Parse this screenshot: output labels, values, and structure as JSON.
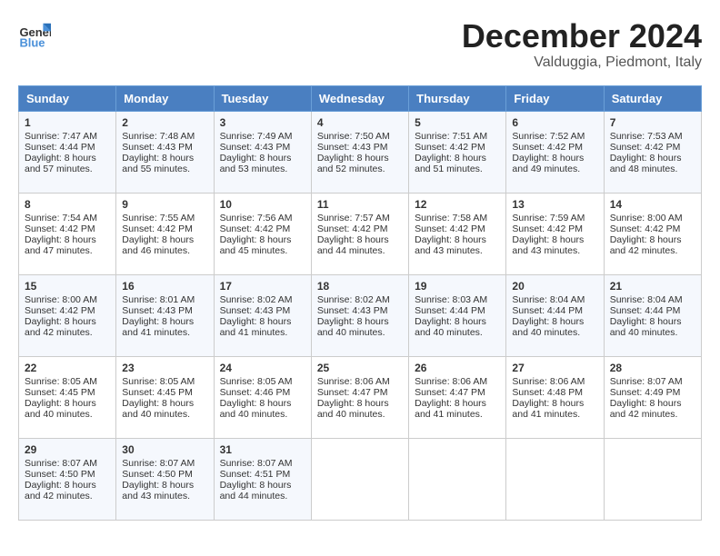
{
  "logo": {
    "line1": "General",
    "line2": "Blue"
  },
  "title": "December 2024",
  "location": "Valduggia, Piedmont, Italy",
  "days_of_week": [
    "Sunday",
    "Monday",
    "Tuesday",
    "Wednesday",
    "Thursday",
    "Friday",
    "Saturday"
  ],
  "weeks": [
    [
      {
        "day": 1,
        "sunrise": "7:47 AM",
        "sunset": "4:44 PM",
        "daylight": "8 hours and 57 minutes."
      },
      {
        "day": 2,
        "sunrise": "7:48 AM",
        "sunset": "4:43 PM",
        "daylight": "8 hours and 55 minutes."
      },
      {
        "day": 3,
        "sunrise": "7:49 AM",
        "sunset": "4:43 PM",
        "daylight": "8 hours and 53 minutes."
      },
      {
        "day": 4,
        "sunrise": "7:50 AM",
        "sunset": "4:43 PM",
        "daylight": "8 hours and 52 minutes."
      },
      {
        "day": 5,
        "sunrise": "7:51 AM",
        "sunset": "4:42 PM",
        "daylight": "8 hours and 51 minutes."
      },
      {
        "day": 6,
        "sunrise": "7:52 AM",
        "sunset": "4:42 PM",
        "daylight": "8 hours and 49 minutes."
      },
      {
        "day": 7,
        "sunrise": "7:53 AM",
        "sunset": "4:42 PM",
        "daylight": "8 hours and 48 minutes."
      }
    ],
    [
      {
        "day": 8,
        "sunrise": "7:54 AM",
        "sunset": "4:42 PM",
        "daylight": "8 hours and 47 minutes."
      },
      {
        "day": 9,
        "sunrise": "7:55 AM",
        "sunset": "4:42 PM",
        "daylight": "8 hours and 46 minutes."
      },
      {
        "day": 10,
        "sunrise": "7:56 AM",
        "sunset": "4:42 PM",
        "daylight": "8 hours and 45 minutes."
      },
      {
        "day": 11,
        "sunrise": "7:57 AM",
        "sunset": "4:42 PM",
        "daylight": "8 hours and 44 minutes."
      },
      {
        "day": 12,
        "sunrise": "7:58 AM",
        "sunset": "4:42 PM",
        "daylight": "8 hours and 43 minutes."
      },
      {
        "day": 13,
        "sunrise": "7:59 AM",
        "sunset": "4:42 PM",
        "daylight": "8 hours and 43 minutes."
      },
      {
        "day": 14,
        "sunrise": "8:00 AM",
        "sunset": "4:42 PM",
        "daylight": "8 hours and 42 minutes."
      }
    ],
    [
      {
        "day": 15,
        "sunrise": "8:00 AM",
        "sunset": "4:42 PM",
        "daylight": "8 hours and 42 minutes."
      },
      {
        "day": 16,
        "sunrise": "8:01 AM",
        "sunset": "4:43 PM",
        "daylight": "8 hours and 41 minutes."
      },
      {
        "day": 17,
        "sunrise": "8:02 AM",
        "sunset": "4:43 PM",
        "daylight": "8 hours and 41 minutes."
      },
      {
        "day": 18,
        "sunrise": "8:02 AM",
        "sunset": "4:43 PM",
        "daylight": "8 hours and 40 minutes."
      },
      {
        "day": 19,
        "sunrise": "8:03 AM",
        "sunset": "4:44 PM",
        "daylight": "8 hours and 40 minutes."
      },
      {
        "day": 20,
        "sunrise": "8:04 AM",
        "sunset": "4:44 PM",
        "daylight": "8 hours and 40 minutes."
      },
      {
        "day": 21,
        "sunrise": "8:04 AM",
        "sunset": "4:44 PM",
        "daylight": "8 hours and 40 minutes."
      }
    ],
    [
      {
        "day": 22,
        "sunrise": "8:05 AM",
        "sunset": "4:45 PM",
        "daylight": "8 hours and 40 minutes."
      },
      {
        "day": 23,
        "sunrise": "8:05 AM",
        "sunset": "4:45 PM",
        "daylight": "8 hours and 40 minutes."
      },
      {
        "day": 24,
        "sunrise": "8:05 AM",
        "sunset": "4:46 PM",
        "daylight": "8 hours and 40 minutes."
      },
      {
        "day": 25,
        "sunrise": "8:06 AM",
        "sunset": "4:47 PM",
        "daylight": "8 hours and 40 minutes."
      },
      {
        "day": 26,
        "sunrise": "8:06 AM",
        "sunset": "4:47 PM",
        "daylight": "8 hours and 41 minutes."
      },
      {
        "day": 27,
        "sunrise": "8:06 AM",
        "sunset": "4:48 PM",
        "daylight": "8 hours and 41 minutes."
      },
      {
        "day": 28,
        "sunrise": "8:07 AM",
        "sunset": "4:49 PM",
        "daylight": "8 hours and 42 minutes."
      }
    ],
    [
      {
        "day": 29,
        "sunrise": "8:07 AM",
        "sunset": "4:50 PM",
        "daylight": "8 hours and 42 minutes."
      },
      {
        "day": 30,
        "sunrise": "8:07 AM",
        "sunset": "4:50 PM",
        "daylight": "8 hours and 43 minutes."
      },
      {
        "day": 31,
        "sunrise": "8:07 AM",
        "sunset": "4:51 PM",
        "daylight": "8 hours and 44 minutes."
      },
      null,
      null,
      null,
      null
    ]
  ]
}
